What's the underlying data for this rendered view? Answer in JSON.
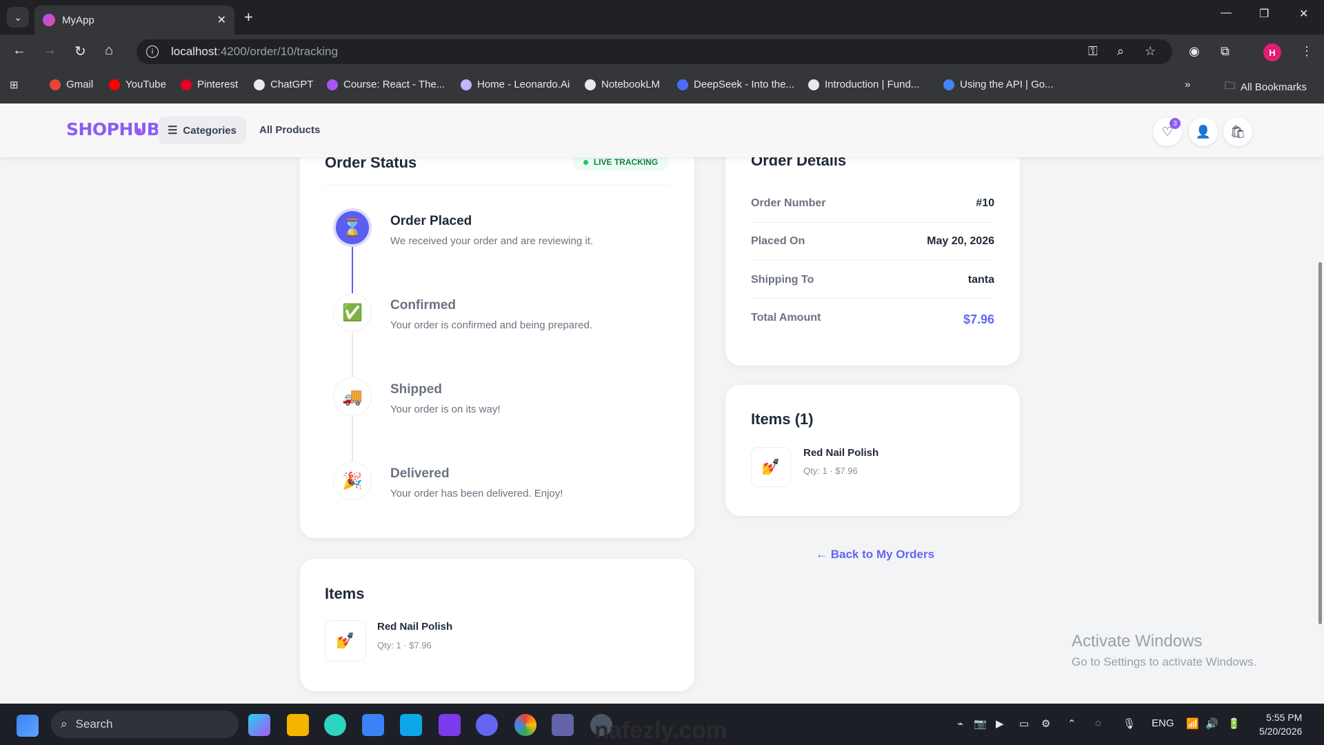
{
  "browser": {
    "tab_title": "MyApp",
    "url_host": "localhost",
    "url_path": ":4200/order/10/tracking",
    "bookmarks": [
      {
        "label": "Gmail",
        "color": "#ea4335"
      },
      {
        "label": "YouTube",
        "color": "#ff0000"
      },
      {
        "label": "Pinterest",
        "color": "#e60023"
      },
      {
        "label": "ChatGPT",
        "color": "#e8eaed"
      },
      {
        "label": "Course: React - The...",
        "color": "#a855f7"
      },
      {
        "label": "Home - Leonardo.Ai",
        "color": "#c4b5fd"
      },
      {
        "label": "NotebookLM",
        "color": "#e8eaed"
      },
      {
        "label": "DeepSeek - Into the...",
        "color": "#4d6bfe"
      },
      {
        "label": "Introduction | Fund...",
        "color": "#e8eaed"
      },
      {
        "label": "Using the API | Go...",
        "color": "#4285f4"
      }
    ],
    "all_bookmarks": "All Bookmarks",
    "profile_initial": "H"
  },
  "header": {
    "logo": "SHOPHUB",
    "categories": "Categories",
    "all_products": "All Products",
    "wishlist_count": "3",
    "accent": "#8b5cf6"
  },
  "status_card": {
    "title": "Order Status",
    "live_label": "LIVE TRACKING",
    "steps": [
      {
        "title": "Order Placed",
        "desc": "We received your order and are reviewing it.",
        "icon": "hourglass-icon",
        "active": true
      },
      {
        "title": "Confirmed",
        "desc": "Your order is confirmed and being prepared.",
        "icon": "check-icon",
        "active": false
      },
      {
        "title": "Shipped",
        "desc": "Your order is on its way!",
        "icon": "truck-icon",
        "active": false
      },
      {
        "title": "Delivered",
        "desc": "Your order has been delivered. Enjoy!",
        "icon": "party-icon",
        "active": false
      }
    ]
  },
  "details_card": {
    "title": "Order Details",
    "rows": [
      {
        "label": "Order Number",
        "value": "#10"
      },
      {
        "label": "Placed On",
        "value": "May 20, 2026"
      },
      {
        "label": "Shipping To",
        "value": "tanta"
      },
      {
        "label": "Total Amount",
        "value": "$7.96",
        "color": "#6366f1"
      }
    ]
  },
  "items_side": {
    "title": "Items (1)",
    "items": [
      {
        "name": "Red Nail Polish",
        "qty": "Qty: 1 · $7.96"
      }
    ]
  },
  "back_link": "← Back to My Orders",
  "items_main": {
    "title": "Items",
    "items": [
      {
        "name": "Red Nail Polish",
        "qty": "Qty: 1 · $7.96"
      }
    ]
  },
  "os": {
    "activate_title": "Activate Windows",
    "activate_sub": "Go to Settings to activate Windows.",
    "search_placeholder": "Search",
    "lang": "ENG",
    "time": "5:55 PM",
    "date": "5/20/2026",
    "watermark": "nafezly.com"
  }
}
